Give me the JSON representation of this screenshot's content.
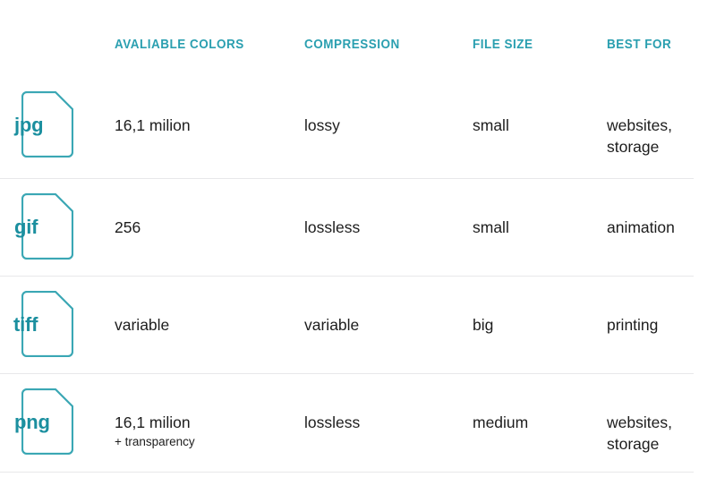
{
  "theme": {
    "accent": "#2a9fb0",
    "icon_outline": "#3aa7b4",
    "icon_text": "#1b8f9f",
    "text": "#1d1d1d",
    "divider": "#e8e8ea",
    "background": "#ffffff"
  },
  "table": {
    "columns": [
      {
        "id": "format",
        "label": ""
      },
      {
        "id": "available_colors",
        "label": "AVALIABLE COLORS"
      },
      {
        "id": "compression",
        "label": "COMPRESSION"
      },
      {
        "id": "file_size",
        "label": "FILE SIZE"
      },
      {
        "id": "best_for",
        "label": "BEST FOR"
      }
    ],
    "rows": [
      {
        "format": "jpg",
        "icon": "file-icon",
        "available_colors": "16,1 milion",
        "available_colors_note": "",
        "compression": "lossy",
        "file_size": "small",
        "best_for_line1": "websites,",
        "best_for_line2": "storage"
      },
      {
        "format": "gif",
        "icon": "file-icon",
        "available_colors": "256",
        "available_colors_note": "",
        "compression": "lossless",
        "file_size": "small",
        "best_for_line1": "animation",
        "best_for_line2": ""
      },
      {
        "format": "tiff",
        "icon": "file-icon",
        "available_colors": "variable",
        "available_colors_note": "",
        "compression": "variable",
        "file_size": "big",
        "best_for_line1": "printing",
        "best_for_line2": ""
      },
      {
        "format": "png",
        "icon": "file-icon",
        "available_colors": "16,1 milion",
        "available_colors_note": "+ transparency",
        "compression": "lossless",
        "file_size": "medium",
        "best_for_line1": "websites,",
        "best_for_line2": "storage"
      }
    ]
  }
}
